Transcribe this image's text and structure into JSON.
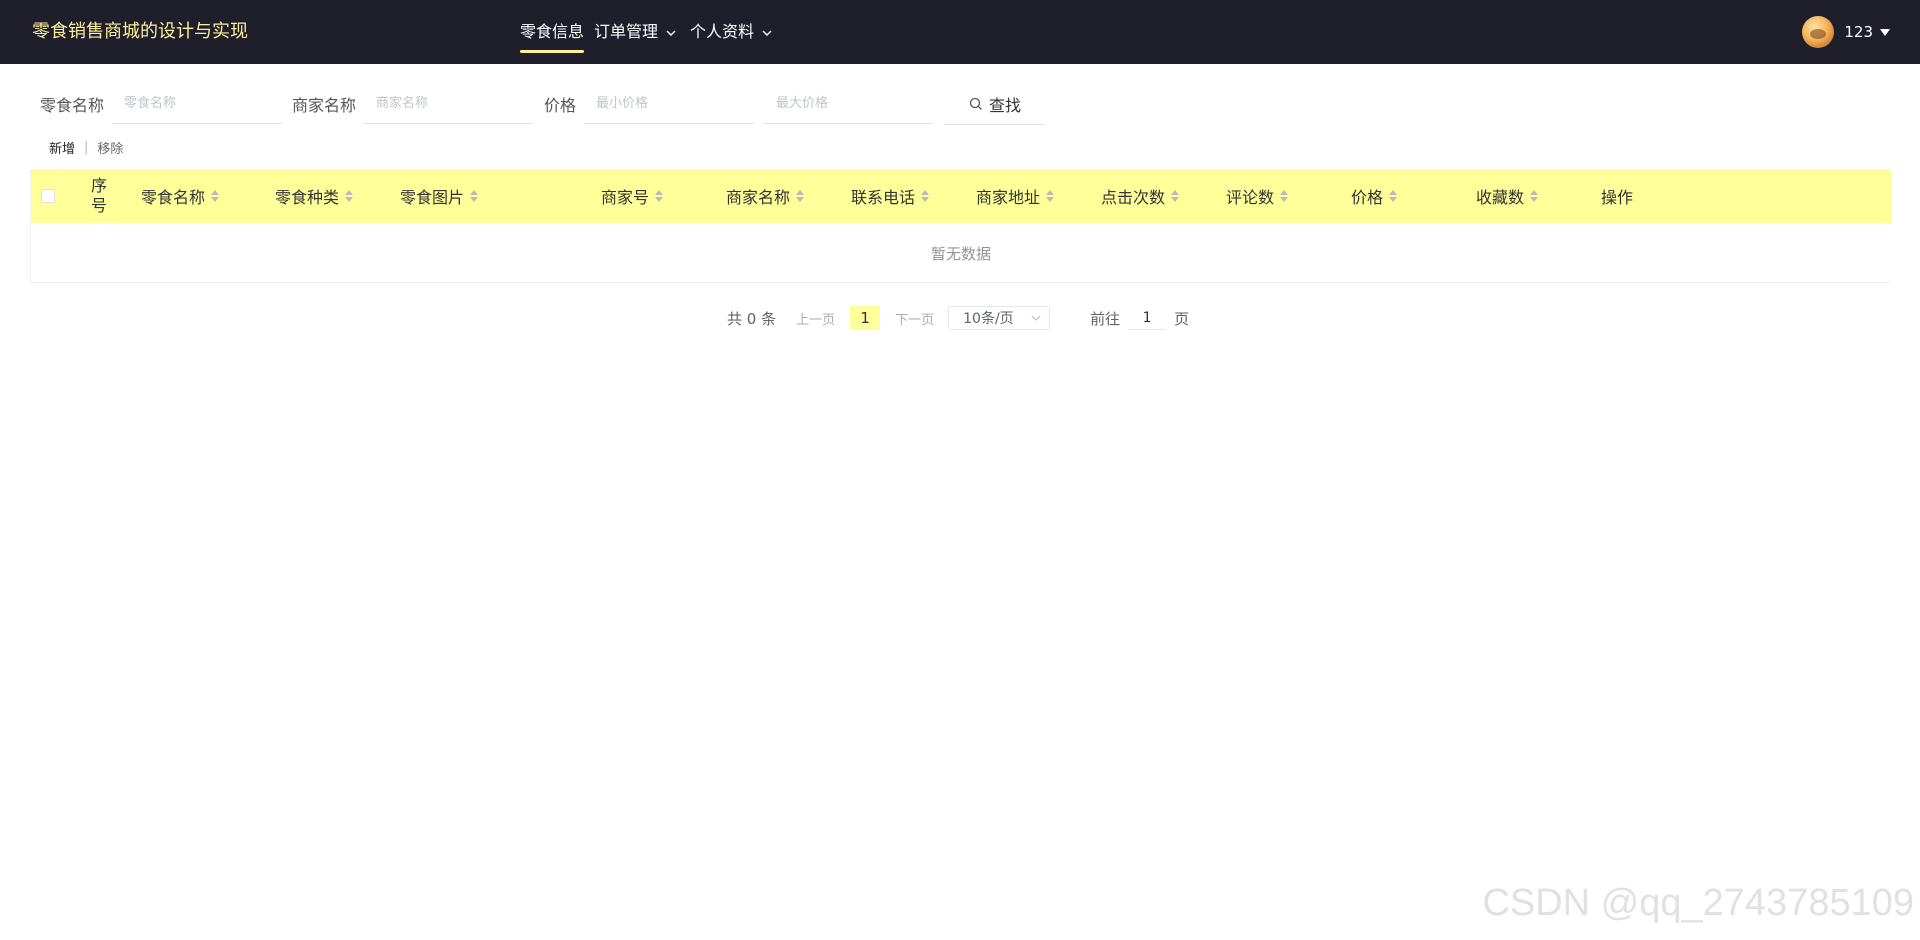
{
  "header": {
    "brand": "零食销售商城的设计与实现",
    "nav": [
      {
        "label": "零食信息",
        "active": true
      },
      {
        "label": "订单管理",
        "dropdown": true
      },
      {
        "label": "个人资料",
        "dropdown": true
      }
    ],
    "user": {
      "name": "123"
    }
  },
  "search": {
    "fields": [
      {
        "label": "零食名称",
        "placeholder": "零食名称"
      },
      {
        "label": "商家名称",
        "placeholder": "商家名称"
      },
      {
        "label": "价格",
        "placeholder": "最小价格"
      },
      {
        "label": "",
        "placeholder": "最大价格"
      }
    ],
    "button_label": "查找"
  },
  "actions": {
    "add_label": "新增",
    "separator": "|",
    "remove_label": "移除"
  },
  "table": {
    "columns": [
      "序号",
      "零食名称",
      "零食种类",
      "零食图片",
      "商家号",
      "商家名称",
      "联系电话",
      "商家地址",
      "点击次数",
      "评论数",
      "价格",
      "收藏数",
      "操作"
    ],
    "empty_text": "暂无数据"
  },
  "pagination": {
    "total_text": "共 0 条",
    "prev_label": "上一页",
    "current_page": "1",
    "next_label": "下一页",
    "page_size_label": "10条/页",
    "goto_label": "前往",
    "goto_value": "1",
    "page_suffix": "页"
  },
  "watermark": "CSDN @qq_2743785109",
  "colors": {
    "topbar_bg": "#1f1f2b",
    "brand_text": "#ffef9a",
    "table_header_bg": "#ffff99",
    "active_page_bg": "#ffff99"
  }
}
